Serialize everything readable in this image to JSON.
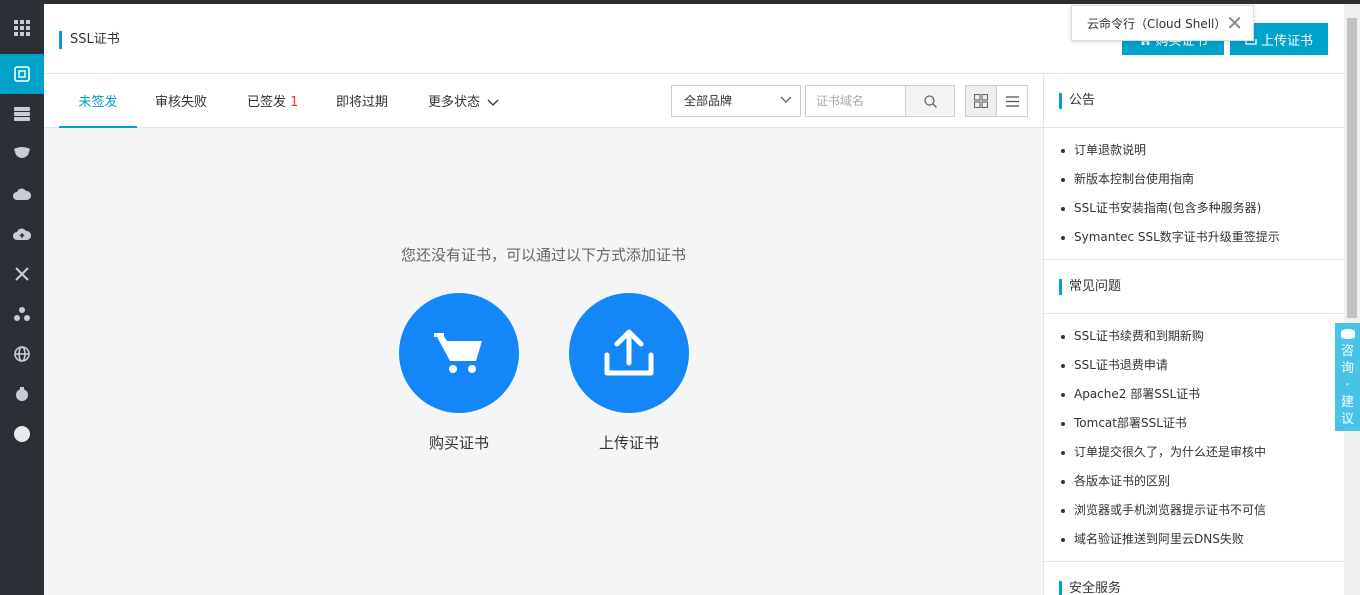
{
  "header": {
    "title": "SSL证书",
    "buy_button": "购买证书",
    "upload_button": "上传证书"
  },
  "tooltip": {
    "text": "云命令行（Cloud Shell）",
    "close": "✕"
  },
  "tabs": [
    {
      "label": "未签发",
      "active": true
    },
    {
      "label": "审核失败"
    },
    {
      "label": "已签发",
      "count": "1"
    },
    {
      "label": "即将过期"
    },
    {
      "label": "更多状态"
    }
  ],
  "filters": {
    "brand_select": "全部品牌",
    "search_placeholder": "证书域名"
  },
  "empty_state": {
    "message": "您还没有证书，可以通过以下方式添加证书",
    "buy_label": "购买证书",
    "upload_label": "上传证书"
  },
  "sidebar": {
    "announcements": {
      "title": "公告",
      "items": [
        "订单退款说明",
        "新版本控制台使用指南",
        "SSL证书安装指南(包含多种服务器)",
        "Symantec SSL数字证书升级重签提示"
      ]
    },
    "faq": {
      "title": "常见问题",
      "items": [
        "SSL证书续费和到期新购",
        "SSL证书退费申请",
        "Apache2 部署SSL证书",
        "Tomcat部署SSL证书",
        "订单提交很久了，为什么还是审核中",
        "各版本证书的区别",
        "浏览器或手机浏览器提示证书不可信",
        "域名验证推送到阿里云DNS失败"
      ]
    },
    "security": {
      "title": "安全服务"
    }
  },
  "consult": [
    "咨",
    "询",
    "·",
    "建",
    "议"
  ],
  "nav_icons": [
    "apps-grid-icon",
    "ssl-certificate-icon",
    "server-list-icon",
    "shield-icon",
    "cloud-icon",
    "cloud-upload-icon",
    "network-icon",
    "nodes-icon",
    "globe-icon",
    "bug-icon",
    "circle-icon"
  ],
  "colors": {
    "accent": "#00a2ca",
    "circle": "#1387f7",
    "count": "#e4393c"
  }
}
